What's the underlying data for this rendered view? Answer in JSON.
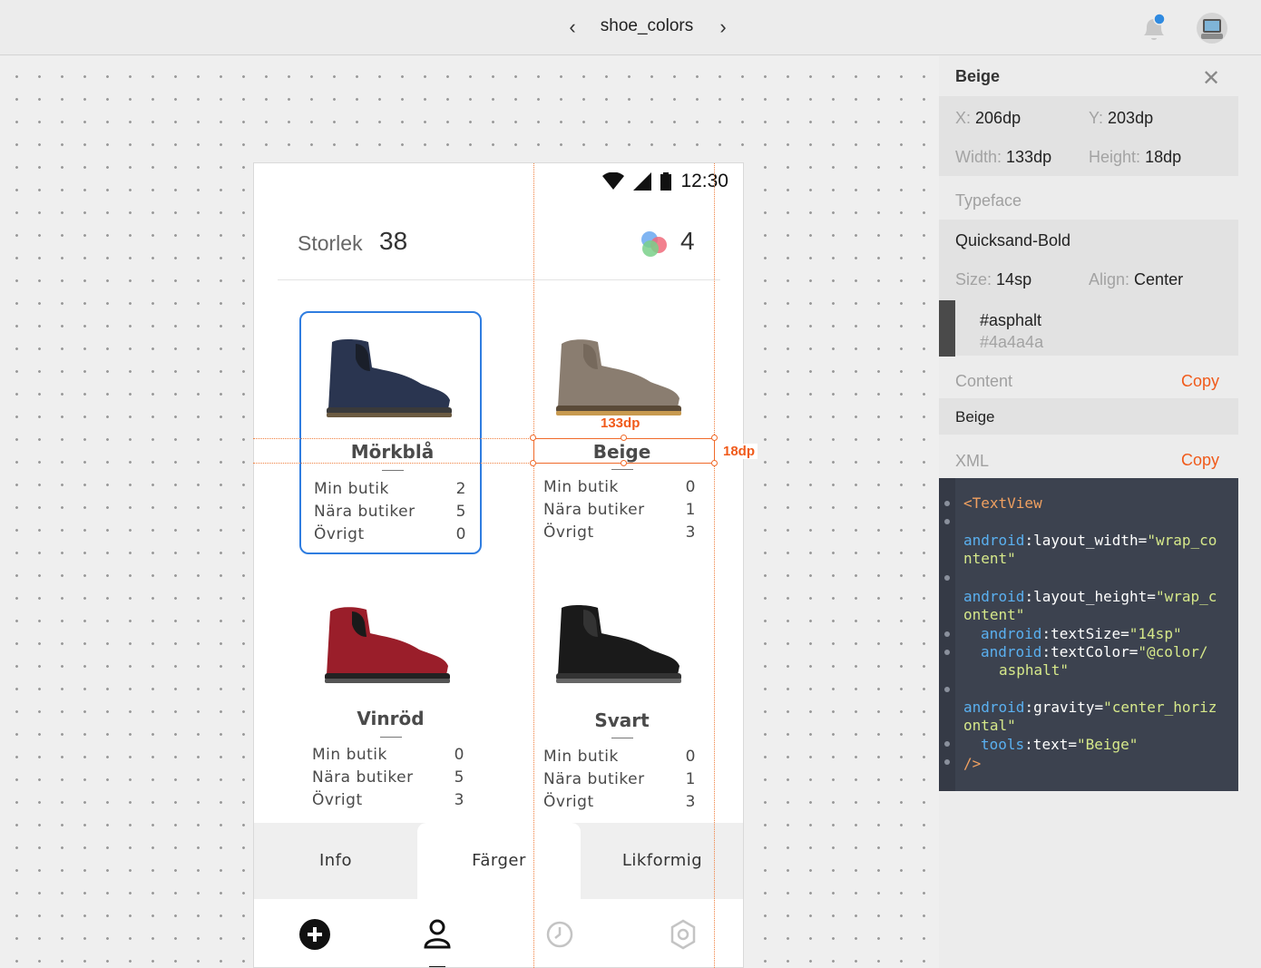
{
  "topbar": {
    "title": "shoe_colors",
    "prev_arrow": "‹",
    "next_arrow": "›",
    "icons": [
      "notification-bell-icon",
      "user-avatar-icon"
    ]
  },
  "phone": {
    "status_time": "12:30",
    "status_icons": [
      "wifi-icon",
      "signal-icon",
      "battery-icon"
    ],
    "header": {
      "size_label": "Storlek",
      "size_value": "38",
      "colors_count": "4",
      "colors_icon": "color-circles-icon"
    },
    "cards": [
      {
        "name": "Mörkblå",
        "selected": true,
        "shoe_color": "#2a3550",
        "stats": [
          {
            "label": "Min butik",
            "value": "2"
          },
          {
            "label": "Nära butiker",
            "value": "5"
          },
          {
            "label": "Övrigt",
            "value": "0"
          }
        ]
      },
      {
        "name": "Beige",
        "selected": false,
        "shoe_color": "#8a7d70",
        "stats": [
          {
            "label": "Min butik",
            "value": "0"
          },
          {
            "label": "Nära butiker",
            "value": "1"
          },
          {
            "label": "Övrigt",
            "value": "3"
          }
        ]
      },
      {
        "name": "Vinröd",
        "selected": false,
        "shoe_color": "#9a1e2a",
        "stats": [
          {
            "label": "Min butik",
            "value": "0"
          },
          {
            "label": "Nära butiker",
            "value": "5"
          },
          {
            "label": "Övrigt",
            "value": "3"
          }
        ]
      },
      {
        "name": "Svart",
        "selected": false,
        "shoe_color": "#1a1a1a",
        "stats": [
          {
            "label": "Min butik",
            "value": "0"
          },
          {
            "label": "Nära butiker",
            "value": "1"
          },
          {
            "label": "Övrigt",
            "value": "3"
          }
        ]
      }
    ],
    "tabs": [
      {
        "label": "Info",
        "active": false
      },
      {
        "label": "Färger",
        "active": true
      },
      {
        "label": "Likformig",
        "active": false
      }
    ],
    "bottom_nav": [
      "add-circle-icon",
      "person-icon",
      "clock-icon",
      "settings-icon"
    ]
  },
  "measurements": {
    "width_label": "133dp",
    "height_label": "18dp",
    "accent": "#f05a1a"
  },
  "inspector": {
    "title": "Beige",
    "x_key": "X:",
    "x_value": "206dp",
    "y_key": "Y:",
    "y_value": "203dp",
    "width_key": "Width:",
    "width_value": "133dp",
    "height_key": "Height:",
    "height_value": "18dp",
    "typeface_label": "Typeface",
    "typeface_value": "Quicksand-Bold",
    "size_key": "Size:",
    "size_value": "14sp",
    "align_key": "Align:",
    "align_value": "Center",
    "color_name": "#asphalt",
    "color_hex": "#4a4a4a",
    "content_label": "Content",
    "content_copy": "Copy",
    "content_value": "Beige",
    "xml_label": "XML",
    "xml_copy": "Copy",
    "xml_lines": [
      {
        "text": "<TextView",
        "kind": "tag"
      },
      {
        "text": "android:layout_width=\"wrap_co",
        "kind": "attr"
      },
      {
        "text": "ntent\"",
        "kind": "plain"
      },
      {
        "text": "android:layout_height=\"wrap_c",
        "kind": "attr"
      },
      {
        "text": "ontent\"",
        "kind": "plain"
      },
      {
        "text": "android:textSize=\"14sp\"",
        "kind": "attr"
      },
      {
        "text": "android:textColor=\"@color/",
        "kind": "attr"
      },
      {
        "text": "asphalt\"",
        "kind": "plain"
      },
      {
        "text": "android:gravity=\"center_horiz",
        "kind": "attr"
      },
      {
        "text": "ontal\"",
        "kind": "plain"
      },
      {
        "text": "tools:text=\"Beige\"",
        "kind": "attr"
      },
      {
        "text": "/>",
        "kind": "tag"
      }
    ]
  }
}
